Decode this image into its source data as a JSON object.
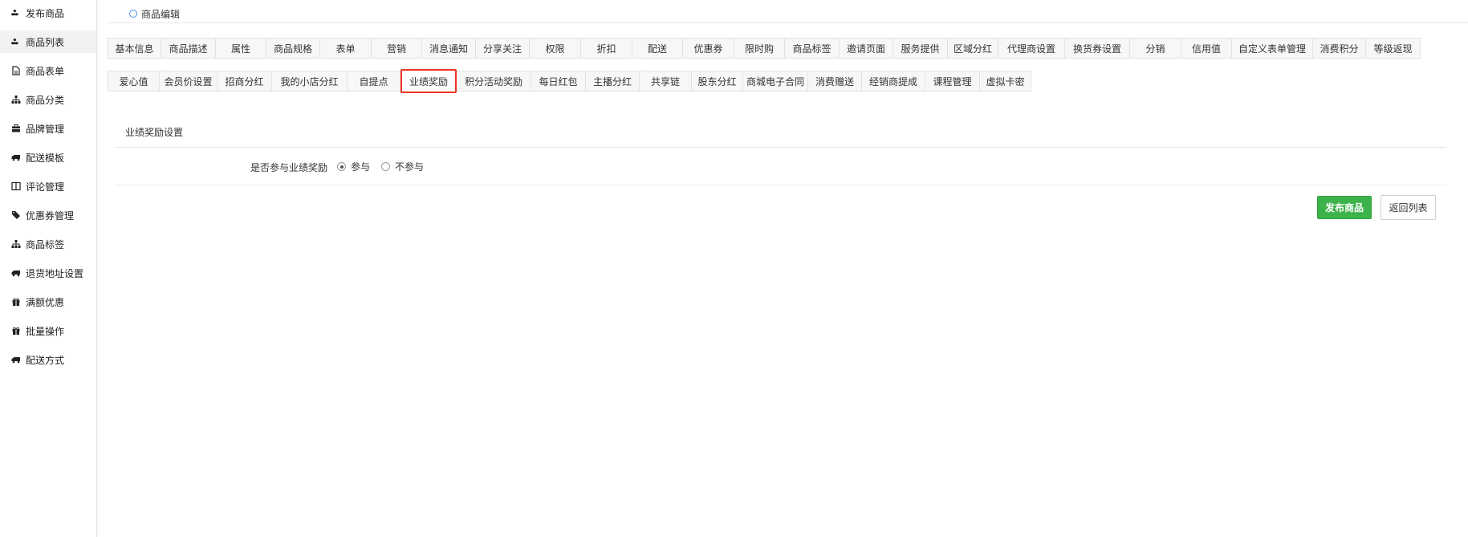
{
  "sidebar": {
    "items": [
      {
        "label": "发布商品",
        "icon": "cubes-icon"
      },
      {
        "label": "商品列表",
        "icon": "cubes-icon"
      },
      {
        "label": "商品表单",
        "icon": "file-icon"
      },
      {
        "label": "商品分类",
        "icon": "sitemap-icon"
      },
      {
        "label": "品牌管理",
        "icon": "briefcase-icon"
      },
      {
        "label": "配送模板",
        "icon": "truck-icon"
      },
      {
        "label": "评论管理",
        "icon": "columns-icon"
      },
      {
        "label": "优惠券管理",
        "icon": "tags-icon"
      },
      {
        "label": "商品标签",
        "icon": "sitemap-icon"
      },
      {
        "label": "退货地址设置",
        "icon": "truck-icon"
      },
      {
        "label": "满额优惠",
        "icon": "gift-icon"
      },
      {
        "label": "批量操作",
        "icon": "gift-icon"
      },
      {
        "label": "配送方式",
        "icon": "truck-icon"
      }
    ],
    "active_index": 1
  },
  "header": {
    "title": "商品编辑"
  },
  "tabs": {
    "row1": [
      "基本信息",
      "商品描述",
      "属性",
      "商品规格",
      "表单",
      "营销",
      "消息通知",
      "分享关注",
      "权限",
      "折扣",
      "配送",
      "优惠券",
      "限时购",
      "商品标签",
      "邀请页面",
      "服务提供",
      "区域分红",
      "代理商设置",
      "换货券设置",
      "分销",
      "信用值",
      "自定义表单管理",
      "消费积分",
      "等级返现"
    ],
    "row2": [
      "爱心值",
      "会员价设置",
      "招商分红",
      "我的小店分红",
      "自提点",
      "业绩奖励",
      "积分活动奖励",
      "每日红包",
      "主播分红",
      "共享链",
      "股东分红",
      "商城电子合同",
      "消费赠送",
      "经销商提成",
      "课程管理",
      "虚拟卡密"
    ],
    "active": "业绩奖励"
  },
  "section": {
    "title": "业绩奖励设置",
    "field_label": "是否参与业绩奖励",
    "options": [
      "参与",
      "不参与"
    ],
    "selected": "参与"
  },
  "buttons": {
    "publish": "发布商品",
    "back": "返回列表"
  },
  "colors": {
    "accent_green": "#3bb34a",
    "active_tab_border": "#e32",
    "title_dot": "#4a90e2"
  }
}
